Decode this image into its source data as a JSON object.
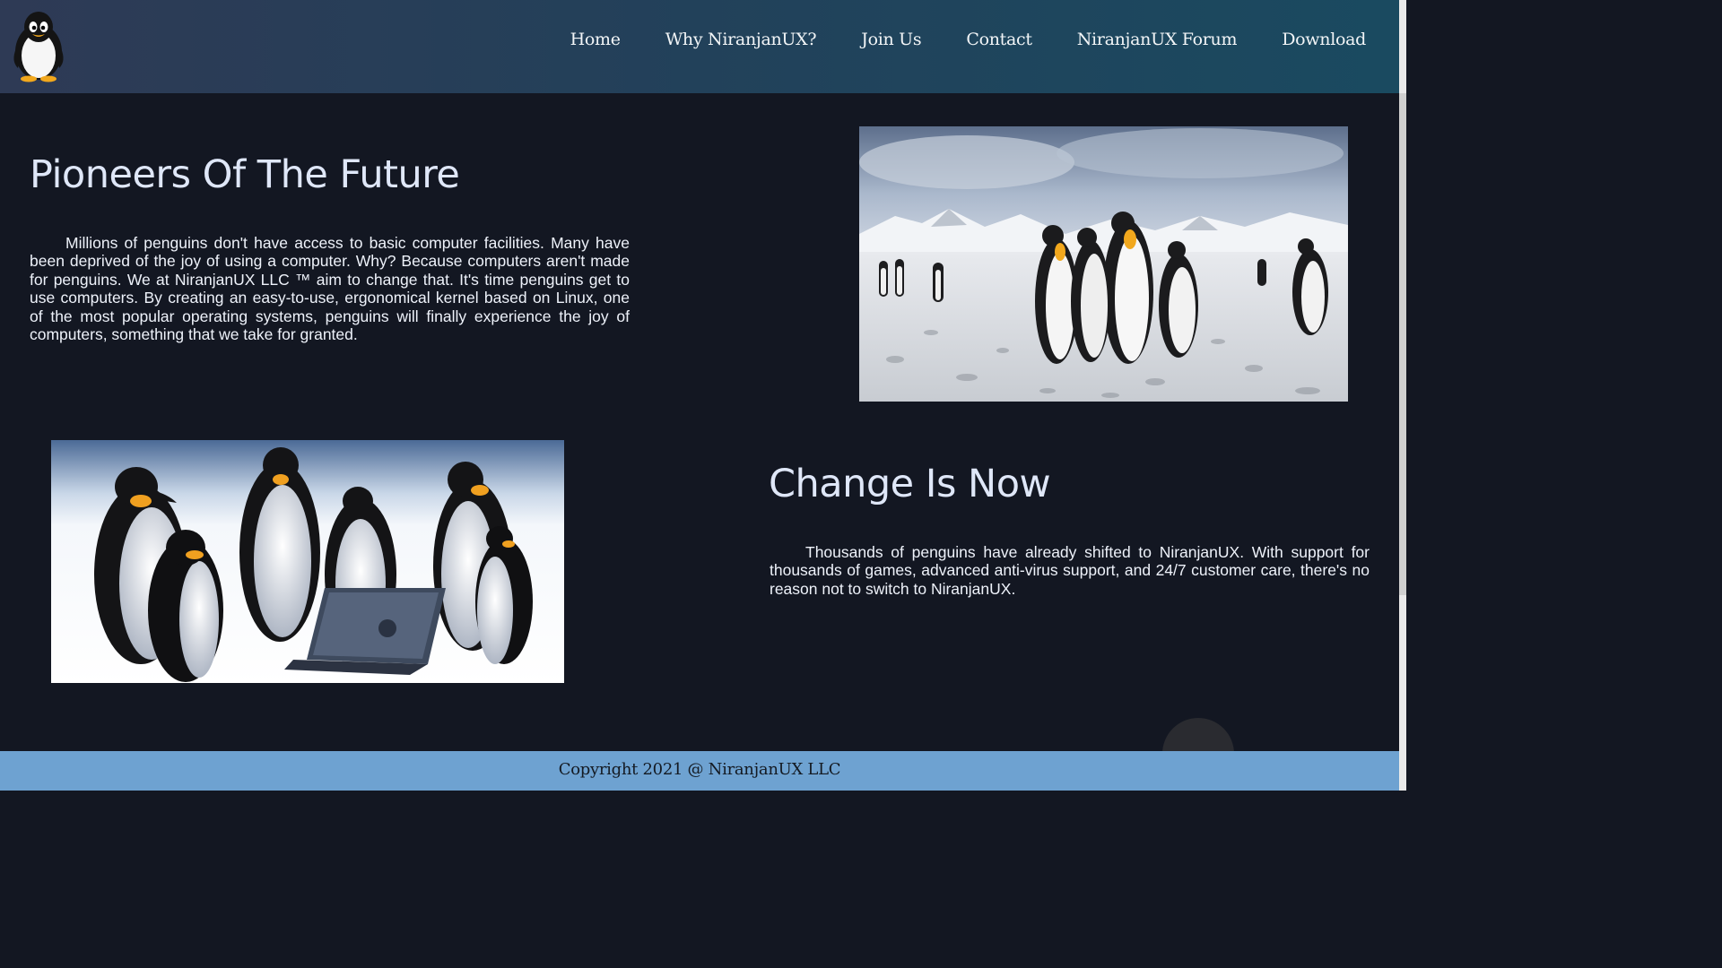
{
  "nav": {
    "logo_icon": "penguin-logo-icon",
    "links": [
      "Home",
      "Why NiranjanUX?",
      "Join Us",
      "Contact",
      "NiranjanUX Forum",
      "Download"
    ]
  },
  "section1": {
    "title": "Pioneers Of The Future",
    "body": "Millions of penguins don't have access to basic computer facilities. Many have been deprived of the joy of using a computer. Why? Because computers aren't made for penguins. We at NiranjanUX LLC ™ aim to change that. It's time penguins get to use computers. By creating an easy-to-use, ergonomical kernel based on Linux, one of the most popular operating systems, penguins will finally experience the joy of computers, something that we take for granted.",
    "image": "penguin-colony-snow-photo"
  },
  "section2": {
    "title": "Change Is Now",
    "body": "Thousands of penguins have already shifted to NiranjanUX. With support for thousands of games, advanced anti-virus support, and 24/7 customer care, there's no reason not to switch to NiranjanUX.",
    "image": "penguins-with-laptop-render"
  },
  "footer": {
    "copyright": "Copyright 2021 @ NiranjanUX LLC"
  },
  "colors": {
    "background": "#131722",
    "footer": "#6ea2d1",
    "heading": "#dfe7f8"
  }
}
